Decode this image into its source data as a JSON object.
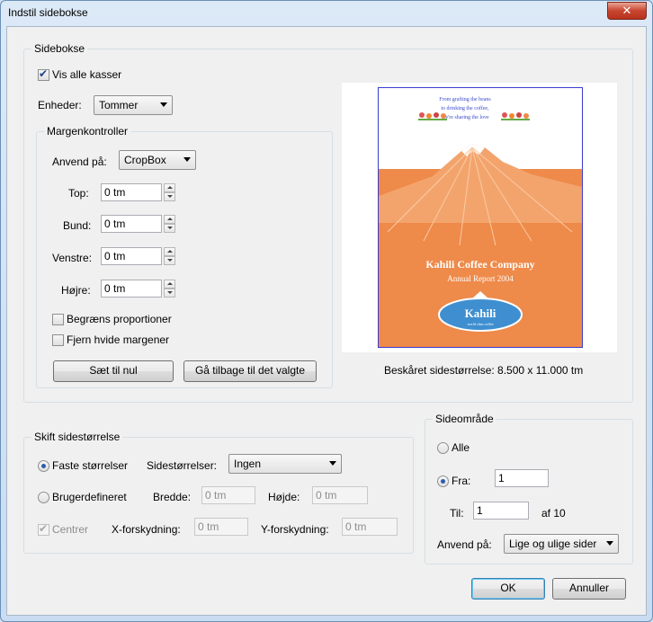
{
  "window": {
    "title": "Indstil sidebokse",
    "close_glyph": "✕"
  },
  "sidebokse": {
    "legend": "Sidebokse",
    "show_all_label": "Vis alle kasser",
    "units_label": "Enheder:",
    "units_value": "Tommer"
  },
  "margin": {
    "legend": "Margenkontroller",
    "apply_label": "Anvend på:",
    "apply_value": "CropBox",
    "top_label": "Top:",
    "top_value": "0 tm",
    "bottom_label": "Bund:",
    "bottom_value": "0 tm",
    "left_label": "Venstre:",
    "left_value": "0 tm",
    "right_label": "Højre:",
    "right_value": "0 tm",
    "constrain_label": "Begræns proportioner",
    "remove_white_label": "Fjern hvide margener",
    "set_zero_btn": "Sæt til nul",
    "revert_btn": "Gå tilbage til det valgte"
  },
  "preview": {
    "cropped_size": "Beskåret sidestørrelse: 8.500 x 11.000 tm",
    "tagline_1": "From grafting the beans",
    "tagline_2": "to drinking the coffee,",
    "tagline_3": "We're sharing the love",
    "company": "Kahili Coffee Company",
    "report": "Annual Report 2004",
    "logo": "Kahili",
    "logo_sub": "world class coffee"
  },
  "page_size": {
    "legend": "Skift sidestørrelse",
    "fixed_label": "Faste størrelser",
    "sizes_label": "Sidestørrelser:",
    "sizes_value": "Ingen",
    "custom_label": "Brugerdefineret",
    "width_label": "Bredde:",
    "width_value": "0 tm",
    "height_label": "Højde:",
    "height_value": "0 tm",
    "center_label": "Centrer",
    "xoffset_label": "X-forskydning:",
    "xoffset_value": "0 tm",
    "yoffset_label": "Y-forskydning:",
    "yoffset_value": "0 tm"
  },
  "page_range": {
    "legend": "Sideområde",
    "all_label": "Alle",
    "from_label": "Fra:",
    "from_value": "1",
    "to_label": "Til:",
    "to_value": "1",
    "of_label": "af 10",
    "apply_label": "Anvend på:",
    "apply_value": "Lige og ulige sider"
  },
  "buttons": {
    "ok": "OK",
    "cancel": "Annuller"
  },
  "colors": {
    "page_orange": "#ee8a4a",
    "mountain": "#f3a46d",
    "banner_blue": "#3f8fd0",
    "accent_blue": "#1f3f8a"
  }
}
